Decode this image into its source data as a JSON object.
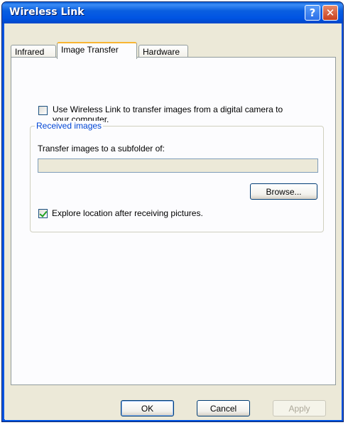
{
  "window": {
    "title": "Wireless Link"
  },
  "titlebar": {
    "help_glyph": "?",
    "close_glyph": "✕",
    "help_icon": "help-icon",
    "close_icon": "close-icon"
  },
  "tabs": [
    {
      "label": "Infrared",
      "active": false
    },
    {
      "label": "Image Transfer",
      "active": true
    },
    {
      "label": "Hardware",
      "active": false
    }
  ],
  "image_transfer": {
    "use_wireless_link": {
      "checked": false,
      "label_line1": "Use Wireless Link to transfer images from a digital camera to",
      "label_line2": "your computer."
    },
    "received_images": {
      "group_label": "Received images",
      "subfolder_label": "Transfer images to a subfolder of:",
      "subfolder_value": "",
      "browse_label": "Browse...",
      "explore_location": {
        "checked": true,
        "label": "Explore location after receiving pictures."
      }
    }
  },
  "buttons": {
    "ok": "OK",
    "cancel": "Cancel",
    "apply": "Apply"
  },
  "colors": {
    "titlebar": "#0054e3",
    "window_bg": "#ece9d8",
    "group_title": "#0046d5",
    "close_button": "#c8401e",
    "tab_highlight": "#f8b532"
  }
}
